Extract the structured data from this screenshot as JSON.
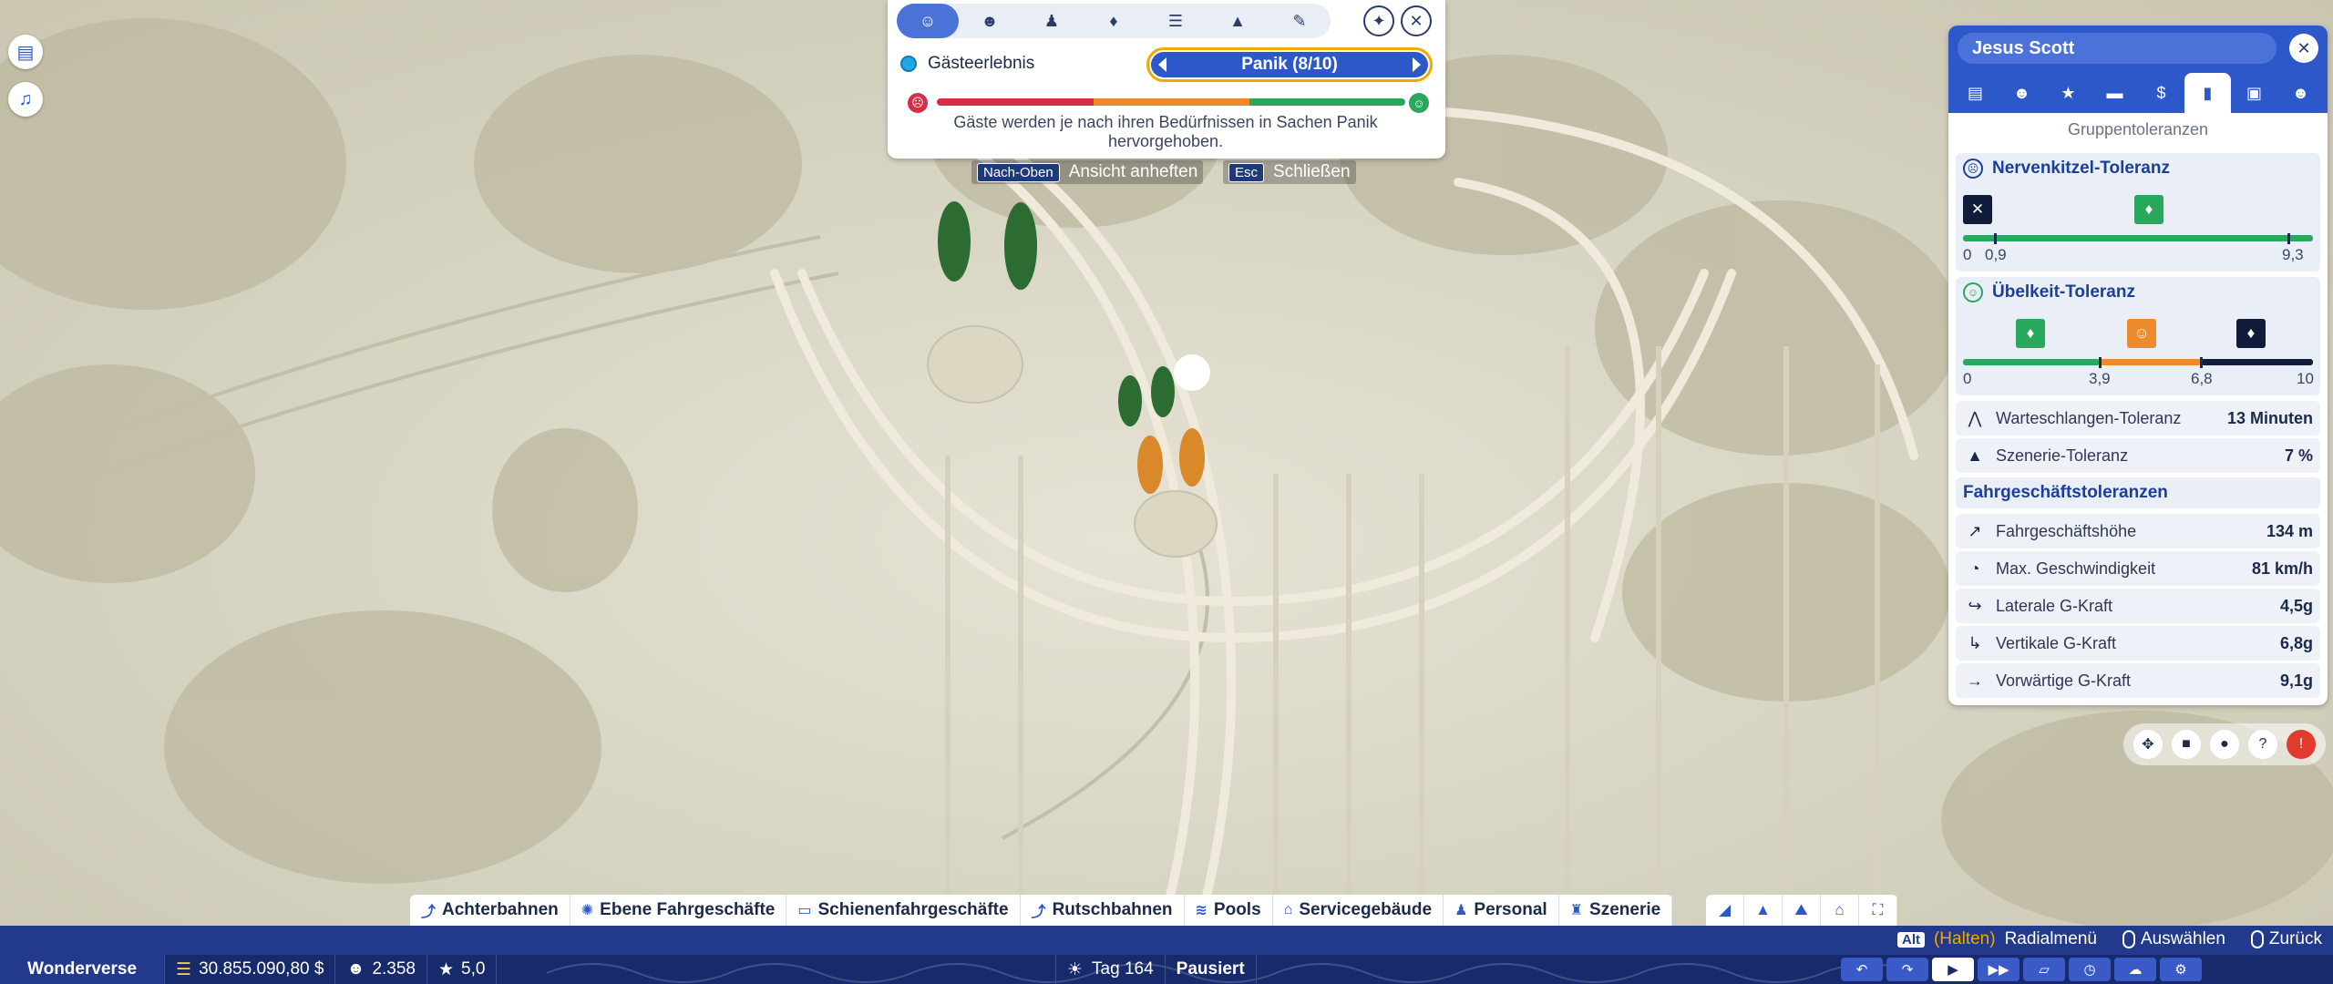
{
  "left_icons": [
    {
      "name": "task-list-icon",
      "glyph": "▤"
    },
    {
      "name": "notification-bell-icon",
      "glyph": "🔔"
    }
  ],
  "overlay": {
    "tabs": [
      {
        "name": "guest-icon",
        "glyph": "👤"
      },
      {
        "name": "group-icon",
        "glyph": "👥"
      },
      {
        "name": "person-icon",
        "glyph": "♟"
      },
      {
        "name": "drops-icon",
        "glyph": "💧"
      },
      {
        "name": "stack-icon",
        "glyph": "☰"
      },
      {
        "name": "tree-icon",
        "glyph": "⛰"
      },
      {
        "name": "wrench-icon",
        "glyph": "🔧"
      }
    ],
    "label": "Gästeerlebnis",
    "selected_value": "Panik (8/10)",
    "description": "Gäste werden je nach ihren Bedürfnissen in Sachen Panik hervorgehoben.",
    "bar_colors": [
      "#d62f45",
      "#ef8a2a",
      "#28a85c"
    ],
    "hint_pin_key": "Nach-Oben",
    "hint_pin_label": "Ansicht anheften",
    "hint_close_key": "Esc",
    "hint_close_label": "Schließen"
  },
  "guest_panel": {
    "name": "Jesus Scott",
    "tabs": [
      "clipboard-icon",
      "group-icon",
      "star-icon",
      "chat-icon",
      "money-icon",
      "stats-icon",
      "inventory-icon",
      "people-icon"
    ],
    "subtitle": "Gruppentoleranzen",
    "thrill": {
      "title": "Nervenkitzel-Toleranz",
      "scale_min": "0",
      "low": "0,9",
      "high": "9,3",
      "scale_min_value": 0,
      "low_value": 0.9,
      "high_value": 9.3,
      "max_value": 10
    },
    "nausea": {
      "title": "Übelkeit-Toleranz",
      "scale_min": "0",
      "mid1": "3,9",
      "mid2": "6,8",
      "scale_max": "10",
      "mid1_value": 3.9,
      "mid2_value": 6.8,
      "max_value": 10
    },
    "queue": {
      "label": "Warteschlangen-Toleranz",
      "value": "13 Minuten"
    },
    "scenery": {
      "label": "Szenerie-Toleranz",
      "value": "7 %"
    },
    "ride_section": "Fahrgeschäftstoleranzen",
    "ride_rows": [
      {
        "icon": "height-icon",
        "glyph": "↗",
        "label": "Fahrgeschäftshöhe",
        "value": "134 m"
      },
      {
        "icon": "speed-icon",
        "glyph": "◔",
        "label": "Max. Geschwindigkeit",
        "value": "81 km/h"
      },
      {
        "icon": "lateral-g-icon",
        "glyph": "↪",
        "label": "Laterale G-Kraft",
        "value": "4,5g"
      },
      {
        "icon": "vertical-g-icon",
        "glyph": "↳",
        "label": "Vertikale G-Kraft",
        "value": "6,8g"
      },
      {
        "icon": "forward-g-icon",
        "glyph": "→",
        "label": "Vorwärtige G-Kraft",
        "value": "9,1g"
      }
    ]
  },
  "tools": [
    {
      "name": "move-icon",
      "glyph": "✥"
    },
    {
      "name": "camera-icon",
      "glyph": "■"
    },
    {
      "name": "location-icon",
      "glyph": "●"
    },
    {
      "name": "help-icon",
      "glyph": "?"
    },
    {
      "name": "alert-icon",
      "glyph": "!"
    }
  ],
  "categories": [
    {
      "icon": "coaster-icon",
      "glyph": "⤴",
      "label": "Achterbahnen"
    },
    {
      "icon": "flat-ride-icon",
      "glyph": "✺",
      "label": "Ebene Fahrgeschäfte"
    },
    {
      "icon": "track-ride-icon",
      "glyph": "▭",
      "label": "Schienenfahrgeschäfte"
    },
    {
      "icon": "slide-icon",
      "glyph": "⤴",
      "label": "Rutschbahnen"
    },
    {
      "icon": "pool-icon",
      "glyph": "≋",
      "label": "Pools"
    },
    {
      "icon": "facility-icon",
      "glyph": "⌂",
      "label": "Servicegebäude"
    },
    {
      "icon": "staff-icon",
      "glyph": "♟",
      "label": "Personal"
    },
    {
      "icon": "scenery-icon",
      "glyph": "♜",
      "label": "Szenerie"
    }
  ],
  "category_icons": [
    {
      "name": "path-icon",
      "glyph": "◢"
    },
    {
      "name": "terrain-tree-icon",
      "glyph": "▲"
    },
    {
      "name": "terrain-icon",
      "glyph": "⛰"
    },
    {
      "name": "blueprint-icon",
      "glyph": "⌂"
    },
    {
      "name": "fullscreen-icon",
      "glyph": "⛶"
    }
  ],
  "hints": {
    "alt_key": "Alt",
    "hold_label": "(Halten)",
    "radial_label": "Radialmenü",
    "select_label": "Auswählen",
    "back_label": "Zurück"
  },
  "status": {
    "park_name": "Wonderverse",
    "money": "30.855.090,80 $",
    "guests": "2.358",
    "rating": "5,0",
    "day": "Tag 164",
    "state": "Pausiert"
  },
  "speed_controls": [
    {
      "name": "undo-icon",
      "glyph": "↶"
    },
    {
      "name": "redo-icon",
      "glyph": "↷"
    },
    {
      "name": "play-icon",
      "glyph": "▶"
    },
    {
      "name": "fast-forward-icon",
      "glyph": "▶▶"
    },
    {
      "name": "map-icon",
      "glyph": "▱"
    },
    {
      "name": "timer-icon",
      "glyph": "◷"
    },
    {
      "name": "weather-icon",
      "glyph": "☁"
    },
    {
      "name": "settings-icon",
      "glyph": "⚙"
    }
  ],
  "colors": {
    "accent": "#2d58c9",
    "highlight": "#f2a800",
    "guest_green": "#2c6b32",
    "guest_orange": "#d9882a"
  }
}
